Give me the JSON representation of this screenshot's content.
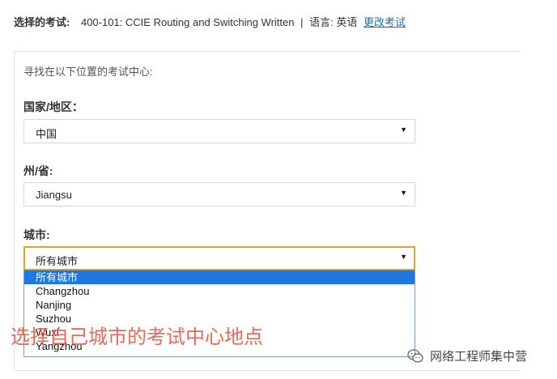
{
  "header": {
    "label": "选择的考试:",
    "exam": "400-101: CCIE Routing and Switching Written",
    "separator": "|",
    "language": "语言: 英语",
    "change_link": "更改考试"
  },
  "panel": {
    "intro": "寻找在以下位置的考试中心:",
    "country": {
      "label": "国家/地区：",
      "value": "中国"
    },
    "state": {
      "label": "州/省:",
      "value": "Jiangsu"
    },
    "city": {
      "label": "城市:",
      "value": "所有城市",
      "options": [
        "所有城市",
        "Changzhou",
        "Nanjing",
        "Suzhou",
        "Wuxi",
        "Yangzhou"
      ],
      "selected_index": 0
    }
  },
  "overlay": {
    "caption": "选择自己城市的考试中心地点"
  },
  "watermark": {
    "text": "网络工程师集中营",
    "icon": "wechat-icon"
  },
  "colors": {
    "link": "#1a6fb3",
    "focus_border": "#e6a32a",
    "highlight": "#1e78e0",
    "caption": "#e86a58"
  },
  "icons": {
    "select_arrow": "caret-down-icon"
  }
}
